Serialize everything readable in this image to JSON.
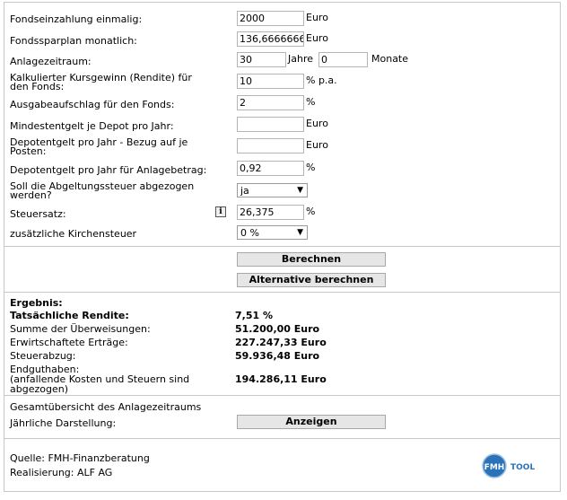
{
  "form": {
    "einzahlung": {
      "label": "Fondseinzahlung einmalig:",
      "value": "2000",
      "unit": "Euro"
    },
    "sparplan": {
      "label": "Fondssparplan monatlich:",
      "value": "136,6666666666",
      "unit": "Euro"
    },
    "anlagezeitraum": {
      "label": "Anlagezeitraum:",
      "years_value": "30",
      "years_unit": "Jahre",
      "months_value": "0",
      "months_unit": "Monate"
    },
    "rendite": {
      "label_line1": "Kalkulierter Kursgewinn (Rendite) für",
      "label_line2": "den Fonds:",
      "value": "10",
      "unit": "% p.a."
    },
    "ausgabeaufschlag": {
      "label": "Ausgabeaufschlag für den Fonds:",
      "value": "2",
      "unit": "%"
    },
    "mindestentgelt": {
      "label": "Mindestentgelt je Depot pro Jahr:",
      "value": "",
      "unit": "Euro"
    },
    "depotentgelt_posten": {
      "label_line1": "Depotentgelt pro Jahr - Bezug auf je",
      "label_line2": "Posten:",
      "value": "",
      "unit": "Euro"
    },
    "depotentgelt_betrag": {
      "label": "Depotentgelt pro Jahr für Anlagebetrag:",
      "value": "0,92",
      "unit": "%"
    },
    "abgeltungssteuer": {
      "label_line1": "Soll die Abgeltungssteuer abgezogen",
      "label_line2": "werden?",
      "selected": "ja"
    },
    "steuersatz": {
      "label": "Steuersatz:",
      "info_glyph": "i",
      "value": "26,375",
      "unit": "%"
    },
    "kirchensteuer": {
      "label": "zusätzliche Kirchensteuer",
      "selected": "0 %"
    }
  },
  "buttons": {
    "berechnen": "Berechnen",
    "alternative": "Alternative berechnen",
    "anzeigen": "Anzeigen"
  },
  "result": {
    "heading": "Ergebnis:",
    "rendite_label": "Tatsächliche Rendite:",
    "rendite_value": "7,51 %",
    "summe_label": "Summe der Überweisungen:",
    "summe_value": "51.200,00 Euro",
    "ertraege_label": "Erwirtschaftete Erträge:",
    "ertraege_value": "227.247,33 Euro",
    "steuer_label": "Steuerabzug:",
    "steuer_value": "59.936,48 Euro",
    "endguthaben_line1": "Endguthaben:",
    "endguthaben_line2": "(anfallende Kosten und Steuern sind",
    "endguthaben_line3": "abgezogen)",
    "endguthaben_value": "194.286,11 Euro"
  },
  "overview": {
    "title": "Gesamtübersicht des Anlagezeitraums",
    "jaehrlich_label": "Jährliche Darstellung:"
  },
  "footer": {
    "quelle": "Quelle: FMH-Finanzberatung",
    "realisierung": "Realisierung: ALF AG",
    "logo_text": "FMH",
    "logo_tool": "TOOL",
    "logo_color": "#2a73b8"
  }
}
